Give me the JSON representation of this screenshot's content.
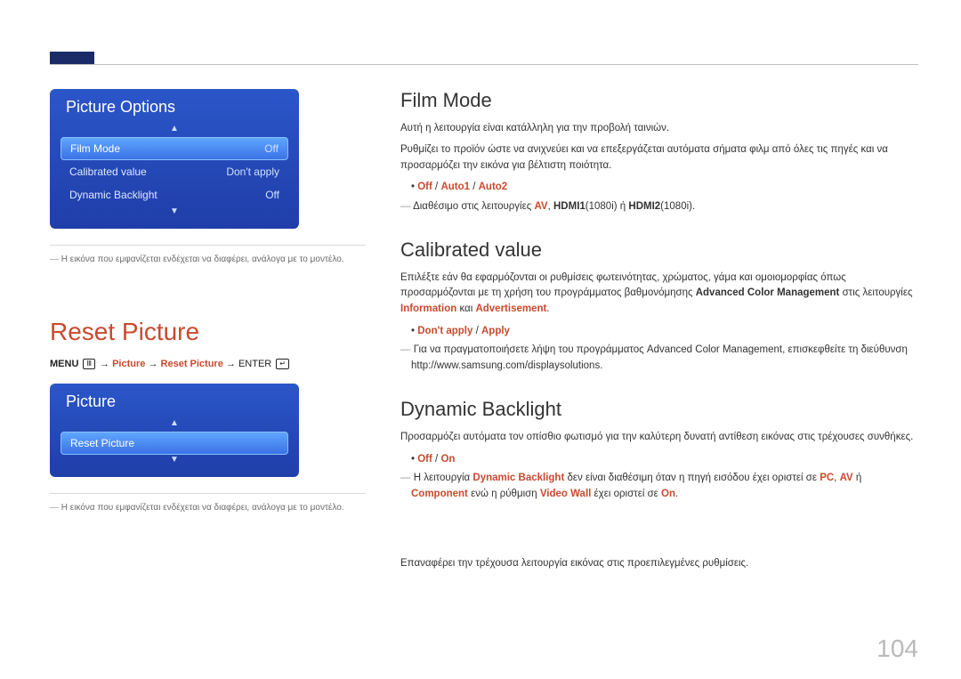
{
  "page_number": "104",
  "left": {
    "osd1": {
      "title": "Picture Options",
      "items": [
        {
          "label": "Film Mode",
          "value": "Off",
          "selected": true
        },
        {
          "label": "Calibrated value",
          "value": "Don't apply",
          "selected": false
        },
        {
          "label": "Dynamic Backlight",
          "value": "Off",
          "selected": false
        }
      ]
    },
    "disclaimer": "Η εικόνα που εμφανίζεται ενδέχεται να διαφέρει, ανάλογα με το μοντέλο.",
    "reset_title": "Reset Picture",
    "menu_path": {
      "menu": "MENU",
      "arrow": "→",
      "picture": "Picture",
      "reset_picture": "Reset Picture",
      "enter": "ENTER"
    },
    "osd2": {
      "title": "Picture",
      "items": [
        {
          "label": "Reset Picture",
          "value": "",
          "selected": true
        }
      ]
    },
    "disclaimer2": "Η εικόνα που εμφανίζεται ενδέχεται να διαφέρει, ανάλογα με το μοντέλο."
  },
  "right": {
    "film_mode": {
      "heading": "Film Mode",
      "p1": "Αυτή η λειτουργία είναι κατάλληλη για την προβολή ταινιών.",
      "p2": "Ρυθμίζει το προϊόν ώστε να ανιχνεύει και να επεξεργάζεται αυτόματα σήματα φιλμ από όλες τις πηγές και να προσαρμόζει την εικόνα για βέλτιστη ποιότητα.",
      "bullet_off": "Off",
      "bullet_sep": " / ",
      "bullet_a1": "Auto1",
      "bullet_a2": "Auto2",
      "note_prefix": "Διαθέσιμο στις λειτουργίες ",
      "note_av": "AV",
      "note_mid1": ", ",
      "note_hdmi1": "HDMI1",
      "note_res": "(1080i)",
      "note_or": " ή ",
      "note_hdmi2": "HDMI2",
      "note_res2": "(1080i)."
    },
    "calibrated": {
      "heading": "Calibrated value",
      "p1a": "Επιλέξτε εάν θα εφαρμόζονται οι ρυθμίσεις φωτεινότητας, χρώματος, γάμα και ομοιομορφίας όπως προσαρμόζονται με τη χρήση του προγράμματος βαθμονόμησης ",
      "p1b": "Advanced Color Management",
      "p1c": " στις λειτουργίες ",
      "p1d": "Information",
      "p1e": " και ",
      "p1f": "Advertisement",
      "p1g": ".",
      "bullet_dont": "Don't apply",
      "bullet_sep": " / ",
      "bullet_apply": "Apply",
      "note": "Για να πραγματοποιήσετε λήψη του προγράμματος Advanced Color Management, επισκεφθείτε τη διεύθυνση http://www.samsung.com/displaysolutions."
    },
    "backlight": {
      "heading": "Dynamic Backlight",
      "p1": "Προσαρμόζει αυτόματα τον οπίσθιο φωτισμό για την καλύτερη δυνατή αντίθεση εικόνας στις τρέχουσες συνθήκες.",
      "bullet_off": "Off",
      "bullet_sep": " / ",
      "bullet_on": "On",
      "note_a": "Η λειτουργία ",
      "note_b": "Dynamic Backlight",
      "note_c": " δεν είναι διαθέσιμη όταν η πηγή εισόδου έχει οριστεί σε ",
      "note_pc": "PC",
      "note_sep1": ", ",
      "note_av": "AV",
      "note_or": " ή ",
      "note_comp": "Component",
      "note_d": " ενώ η ρύθμιση ",
      "note_vw": "Video Wall",
      "note_e": " έχει οριστεί σε ",
      "note_on": "On",
      "note_f": "."
    },
    "reset": {
      "p": "Επαναφέρει την τρέχουσα λειτουργία εικόνας στις προεπιλεγμένες ρυθμίσεις."
    }
  }
}
